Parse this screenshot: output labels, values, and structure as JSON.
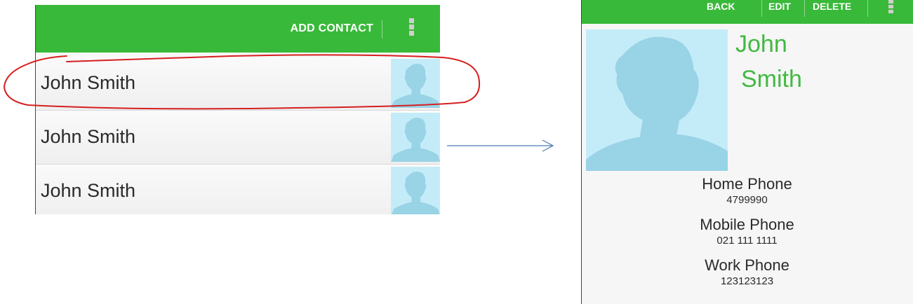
{
  "list_screen": {
    "action_bar": {
      "add_contact_label": "ADD CONTACT",
      "overflow_icon": "overflow-menu-icon"
    },
    "contacts": [
      {
        "name": "John Smith",
        "icon": "contact-avatar-icon"
      },
      {
        "name": "John Smith",
        "icon": "contact-avatar-icon"
      },
      {
        "name": "John Smith",
        "icon": "contact-avatar-icon"
      }
    ],
    "highlighted_index": 0
  },
  "detail_screen": {
    "action_bar": {
      "back_label": "BACK",
      "edit_label": "EDIT",
      "delete_label": "DELETE",
      "overflow_icon": "overflow-menu-icon"
    },
    "name_first": "John",
    "name_last": "Smith",
    "phones": [
      {
        "label": "Home Phone",
        "value": "4799990"
      },
      {
        "label": "Mobile Phone",
        "value": "021 111 1111"
      },
      {
        "label": "Work Phone",
        "value": "123123123"
      }
    ]
  },
  "colors": {
    "action_bar": "#39b939",
    "name_accent": "#41b941",
    "avatar_bg": "#c4ecf8",
    "avatar_silhouette": "#99d3e6",
    "highlight_annotation": "#d61f1f",
    "arrow": "#4a7ab5"
  }
}
